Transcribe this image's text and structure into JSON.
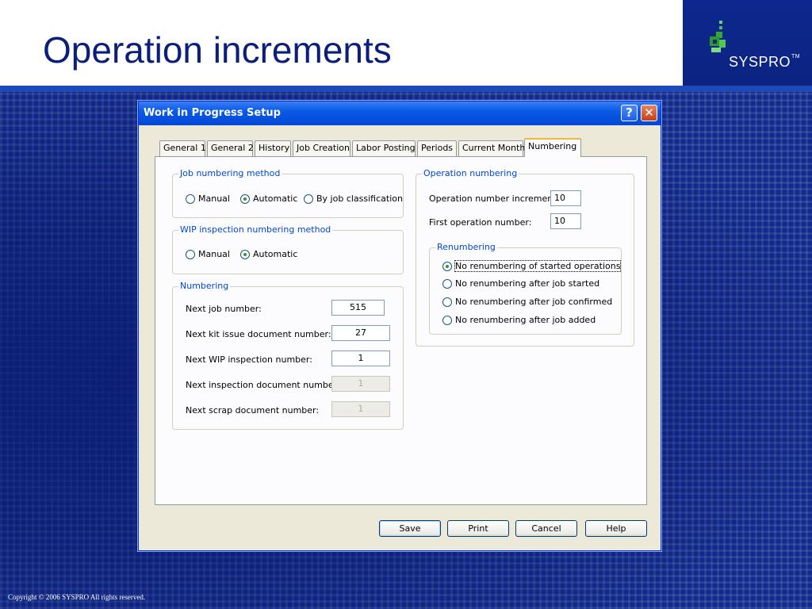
{
  "slide": {
    "title": "Operation increments",
    "logo_text": "SYSPRO",
    "logo_tm": "TM",
    "copyright": "Copyright © 2006 SYSPRO All rights reserved."
  },
  "dialog": {
    "title": "Work in Progress Setup",
    "help_glyph": "?",
    "close_glyph": "✕",
    "tabs": [
      "General 1",
      "General 2",
      "History",
      "Job Creation",
      "Labor Posting",
      "Periods",
      "Current Month",
      "Numbering"
    ],
    "active_tab": "Numbering",
    "job_numbering": {
      "legend": "Job numbering method",
      "options": [
        "Manual",
        "Automatic",
        "By job classification"
      ],
      "selected": "Automatic"
    },
    "wip_inspection": {
      "legend": "WIP inspection numbering method",
      "options": [
        "Manual",
        "Automatic"
      ],
      "selected": "Automatic"
    },
    "numbering": {
      "legend": "Numbering",
      "rows": [
        {
          "label": "Next job number:",
          "value": "515",
          "enabled": true
        },
        {
          "label": "Next  kit issue document number:",
          "value": "27",
          "enabled": true
        },
        {
          "label": "Next WIP inspection number:",
          "value": "1",
          "enabled": true
        },
        {
          "label": "Next inspection document number:",
          "value": "1",
          "enabled": false
        },
        {
          "label": "Next scrap document number:",
          "value": "1",
          "enabled": false
        }
      ]
    },
    "operation_numbering": {
      "legend": "Operation numbering",
      "increment_label": "Operation number increment:",
      "increment_value": "10",
      "first_label": "First operation number:",
      "first_value": "10"
    },
    "renumbering": {
      "legend": "Renumbering",
      "options": [
        "No renumbering of started operations",
        "No renumbering after job started",
        "No renumbering after job confirmed",
        "No renumbering after job added"
      ],
      "selected": "No renumbering of started operations"
    },
    "buttons": {
      "save": "Save",
      "print": "Print",
      "cancel": "Cancel",
      "help": "Help"
    }
  },
  "colors": {
    "slide_title": "#0b1f7a",
    "background": "#112a8c",
    "titlebar": "#0a5ae6",
    "group_legend": "#0046d5",
    "tab_highlight": "#f1b73e"
  }
}
